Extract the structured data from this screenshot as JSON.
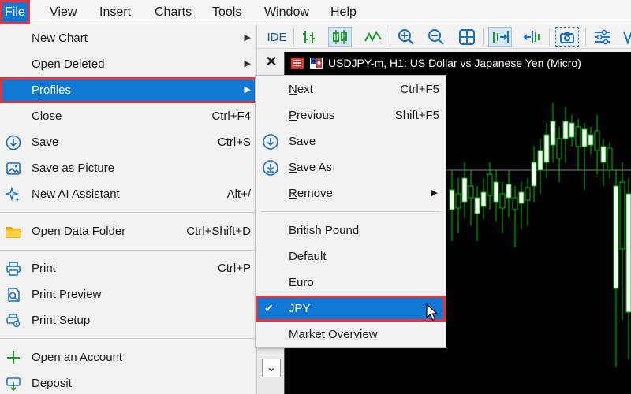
{
  "menubar": {
    "items": [
      {
        "label": "File"
      },
      {
        "label": "View"
      },
      {
        "label": "Insert"
      },
      {
        "label": "Charts"
      },
      {
        "label": "Tools"
      },
      {
        "label": "Window"
      },
      {
        "label": "Help"
      }
    ]
  },
  "toolbar": {
    "ide_label": "IDE",
    "icons": [
      "bar-chart-icon",
      "candlestick-icon",
      "line-chart-icon",
      "zoom-in-icon",
      "zoom-out-icon",
      "tile-windows-icon",
      "autoscroll-icon",
      "chart-shift-icon",
      "screenshot-icon",
      "indicators-icon"
    ]
  },
  "chart": {
    "title": "USDJPY-m, H1:  US Dollar vs Japanese Yen (Micro)",
    "close_glyph": "✕",
    "scroll_glyph": "⌄"
  },
  "file_menu": {
    "items": [
      {
        "label": "New Chart",
        "shortcut": "",
        "submenu": true,
        "icon": ""
      },
      {
        "label": "Open Deleted",
        "shortcut": "",
        "submenu": true,
        "icon": ""
      },
      {
        "label": "Profiles",
        "shortcut": "",
        "submenu": true,
        "icon": ""
      },
      {
        "label": "Close",
        "shortcut": "Ctrl+F4",
        "submenu": false,
        "icon": ""
      },
      {
        "label": "Save",
        "shortcut": "Ctrl+S",
        "submenu": false,
        "icon": "save-icon"
      },
      {
        "label": "Save as Picture",
        "shortcut": "",
        "submenu": false,
        "icon": "picture-icon"
      },
      {
        "label": "New AI Assistant",
        "shortcut": "Alt+/",
        "submenu": false,
        "icon": "sparkle-icon"
      },
      {
        "label": "Open Data Folder",
        "shortcut": "Ctrl+Shift+D",
        "submenu": false,
        "icon": "folder-icon"
      },
      {
        "label": "Print",
        "shortcut": "Ctrl+P",
        "submenu": false,
        "icon": "printer-icon"
      },
      {
        "label": "Print Preview",
        "shortcut": "",
        "submenu": false,
        "icon": "print-preview-icon"
      },
      {
        "label": "Print Setup",
        "shortcut": "",
        "submenu": false,
        "icon": "print-setup-icon"
      },
      {
        "label": "Open an Account",
        "shortcut": "",
        "submenu": false,
        "icon": "plus-icon"
      },
      {
        "label": "Deposit",
        "shortcut": "",
        "submenu": false,
        "icon": "deposit-icon"
      }
    ]
  },
  "profiles_menu": {
    "items": [
      {
        "label": "Next",
        "shortcut": "Ctrl+F5"
      },
      {
        "label": "Previous",
        "shortcut": "Shift+F5"
      },
      {
        "label": "Save",
        "shortcut": "",
        "icon": "save-profile-icon"
      },
      {
        "label": "Save As",
        "shortcut": "",
        "icon": "save-as-icon"
      },
      {
        "label": "Remove",
        "shortcut": "",
        "submenu": true
      },
      {
        "label": "British Pound"
      },
      {
        "label": "Default"
      },
      {
        "label": "Euro"
      },
      {
        "label": "JPY",
        "checked": true
      },
      {
        "label": "Market Overview"
      }
    ]
  },
  "colors": {
    "selection": "#0f78d4",
    "highlight": "#e5343e",
    "bull_candle": "#ffffff",
    "bear_candle": "#000000",
    "wick": "#00c000",
    "grid": "#808080"
  }
}
